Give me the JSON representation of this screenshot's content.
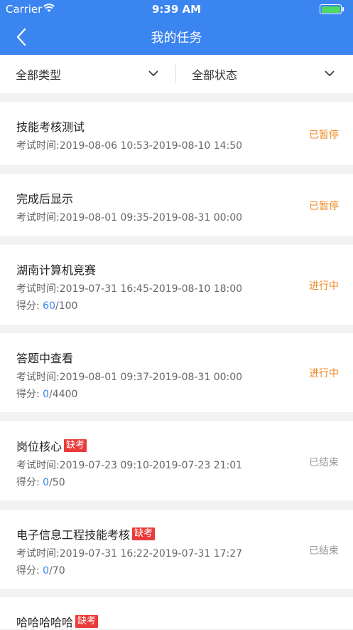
{
  "status_bar": {
    "carrier": "Carrier",
    "time": "9:39 AM"
  },
  "header": {
    "title": "我的任务"
  },
  "filters": {
    "type_label": "全部类型",
    "status_label": "全部状态"
  },
  "tasks": [
    {
      "name": "技能考核测试",
      "time": "考试时间:2019-08-06 10:53-2019-08-10 14:50",
      "status": "已暂停"
    },
    {
      "name": "完成后显示",
      "time": "考试时间:2019-08-01 09:35-2019-08-31 00:00",
      "status": "已暂停"
    },
    {
      "name": "湖南计算机竞赛",
      "time": "考试时间:2019-07-31 16:45-2019-08-10 18:00",
      "score_prefix": "得分: ",
      "score": "60",
      "total": "/100",
      "status": "进行中"
    },
    {
      "name": "答题中查看",
      "time": "考试时间:2019-08-01 09:37-2019-08-31 00:00",
      "score_prefix": "得分: ",
      "score": "0",
      "total": "/4400",
      "status": "进行中"
    },
    {
      "name": "岗位核心",
      "badge": "缺考",
      "time": "考试时间:2019-07-23 09:10-2019-07-23 21:01",
      "score_prefix": "得分: ",
      "score": "0",
      "total": "/50",
      "status": "已结束"
    },
    {
      "name": "电子信息工程技能考核",
      "badge": "缺考",
      "time": "考试时间:2019-07-31 16:22-2019-07-31 17:27",
      "score_prefix": "得分: ",
      "score": "0",
      "total": "/70",
      "status": "已结束"
    },
    {
      "name": "哈哈哈哈哈",
      "badge": "缺考"
    }
  ]
}
